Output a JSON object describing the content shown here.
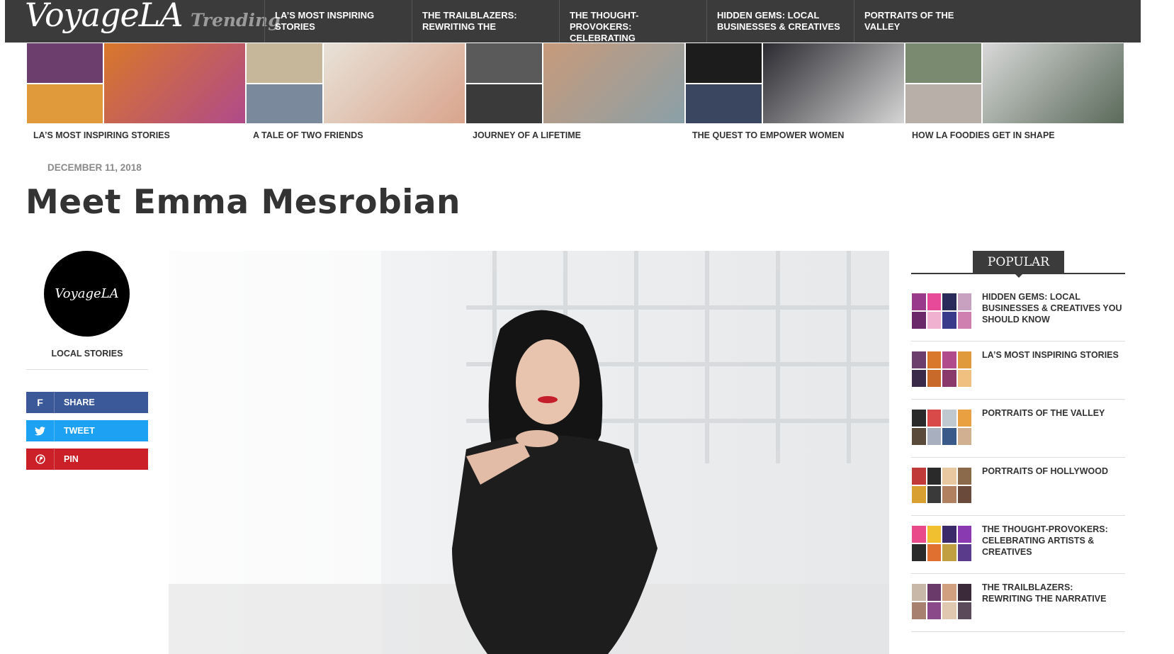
{
  "header": {
    "logo": "VoyageLA",
    "trending_label": "Trending",
    "trending_items": [
      {
        "label": "LA’S MOST INSPIRING STORIES"
      },
      {
        "label": "THE TRAILBLAZERS: REWRITING THE"
      },
      {
        "label": "THE THOUGHT-PROVOKERS: CELEBRATING"
      },
      {
        "label": "HIDDEN GEMS: LOCAL BUSINESSES & CREATIVES"
      },
      {
        "label": "PORTRAITS OF THE VALLEY"
      }
    ]
  },
  "featured": [
    {
      "caption": "LA’S MOST INSPIRING STORIES",
      "colors": [
        "#6b3e6e",
        "#d9772a",
        "#b04a8a",
        "#e09a3c"
      ]
    },
    {
      "caption": "A TALE OF TWO FRIENDS",
      "colors": [
        "#c7b79a",
        "#e8e2d8",
        "#d9a48c",
        "#7a8a9c"
      ]
    },
    {
      "caption": "JOURNEY OF A LIFETIME",
      "colors": [
        "#5a5a5a",
        "#c89a7a",
        "#8aa0a8",
        "#3a3a3a"
      ]
    },
    {
      "caption": "THE QUEST TO EMPOWER WOMEN",
      "colors": [
        "#1c1c1c",
        "#2a2a30",
        "#d5d5d5",
        "#3a4660"
      ]
    },
    {
      "caption": "HOW LA FOODIES GET IN SHAPE",
      "colors": [
        "#7a8a70",
        "#d8d8d8",
        "#5a6a5a",
        "#b8b0a8"
      ]
    }
  ],
  "article": {
    "date": "DECEMBER 11, 2018",
    "title": "Meet Emma Mesrobian",
    "avatar_text": "VoyageLA",
    "category": "LOCAL STORIES"
  },
  "share": {
    "facebook": "SHARE",
    "twitter": "TWEET",
    "pinterest": "PIN"
  },
  "icons": {
    "facebook": "f",
    "twitter": "🐦",
    "pinterest": "℗"
  },
  "popular": {
    "heading": "POPULAR",
    "items": [
      {
        "label": "HIDDEN GEMS: LOCAL BUSINESSES & CREATIVES YOU SHOULD KNOW",
        "colors": [
          "#9a3a8a",
          "#e84a9a",
          "#2a2a5a",
          "#c8a0c0",
          "#6a2a6a",
          "#f0b0d0",
          "#3a3a8a",
          "#d080b0"
        ]
      },
      {
        "label": "LA’S MOST INSPIRING STORIES",
        "colors": [
          "#6b3e6e",
          "#d9772a",
          "#b04a8a",
          "#e09a3c",
          "#3a2a4a",
          "#c86a2a",
          "#8a3a6a",
          "#f0c080"
        ]
      },
      {
        "label": "PORTRAITS OF THE VALLEY",
        "colors": [
          "#2a2a2a",
          "#d84a4a",
          "#c0c8d0",
          "#e8a040",
          "#5a4a3a",
          "#a8b0c0",
          "#3a5a8a",
          "#d0b090"
        ]
      },
      {
        "label": "PORTRAITS OF HOLLYWOOD",
        "colors": [
          "#c03a3a",
          "#2a2a2a",
          "#e8c8a0",
          "#8a6a4a",
          "#d8a030",
          "#3a3a3a",
          "#b08060",
          "#6a4a3a"
        ]
      },
      {
        "label": "THE THOUGHT-PROVOKERS: CELEBRATING ARTISTS & CREATIVES",
        "colors": [
          "#e84a8a",
          "#f0c030",
          "#3a2a6a",
          "#8a3ab0",
          "#2a2a2a",
          "#e07030",
          "#c0a040",
          "#5a3a8a"
        ]
      },
      {
        "label": "THE TRAILBLAZERS: REWRITING THE NARRATIVE",
        "colors": [
          "#c8b8a8",
          "#6a3a6a",
          "#d0a080",
          "#3a2a3a",
          "#a88070",
          "#8a4a8a",
          "#e0c8b0",
          "#5a4a5a"
        ]
      }
    ]
  }
}
